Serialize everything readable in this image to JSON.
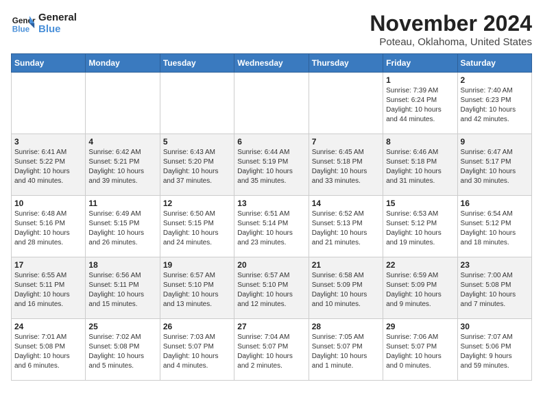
{
  "header": {
    "logo_line1": "General",
    "logo_line2": "Blue",
    "title": "November 2024",
    "subtitle": "Poteau, Oklahoma, United States"
  },
  "weekdays": [
    "Sunday",
    "Monday",
    "Tuesday",
    "Wednesday",
    "Thursday",
    "Friday",
    "Saturday"
  ],
  "weeks": [
    [
      {
        "day": "",
        "detail": ""
      },
      {
        "day": "",
        "detail": ""
      },
      {
        "day": "",
        "detail": ""
      },
      {
        "day": "",
        "detail": ""
      },
      {
        "day": "",
        "detail": ""
      },
      {
        "day": "1",
        "detail": "Sunrise: 7:39 AM\nSunset: 6:24 PM\nDaylight: 10 hours\nand 44 minutes."
      },
      {
        "day": "2",
        "detail": "Sunrise: 7:40 AM\nSunset: 6:23 PM\nDaylight: 10 hours\nand 42 minutes."
      }
    ],
    [
      {
        "day": "3",
        "detail": "Sunrise: 6:41 AM\nSunset: 5:22 PM\nDaylight: 10 hours\nand 40 minutes."
      },
      {
        "day": "4",
        "detail": "Sunrise: 6:42 AM\nSunset: 5:21 PM\nDaylight: 10 hours\nand 39 minutes."
      },
      {
        "day": "5",
        "detail": "Sunrise: 6:43 AM\nSunset: 5:20 PM\nDaylight: 10 hours\nand 37 minutes."
      },
      {
        "day": "6",
        "detail": "Sunrise: 6:44 AM\nSunset: 5:19 PM\nDaylight: 10 hours\nand 35 minutes."
      },
      {
        "day": "7",
        "detail": "Sunrise: 6:45 AM\nSunset: 5:18 PM\nDaylight: 10 hours\nand 33 minutes."
      },
      {
        "day": "8",
        "detail": "Sunrise: 6:46 AM\nSunset: 5:18 PM\nDaylight: 10 hours\nand 31 minutes."
      },
      {
        "day": "9",
        "detail": "Sunrise: 6:47 AM\nSunset: 5:17 PM\nDaylight: 10 hours\nand 30 minutes."
      }
    ],
    [
      {
        "day": "10",
        "detail": "Sunrise: 6:48 AM\nSunset: 5:16 PM\nDaylight: 10 hours\nand 28 minutes."
      },
      {
        "day": "11",
        "detail": "Sunrise: 6:49 AM\nSunset: 5:15 PM\nDaylight: 10 hours\nand 26 minutes."
      },
      {
        "day": "12",
        "detail": "Sunrise: 6:50 AM\nSunset: 5:15 PM\nDaylight: 10 hours\nand 24 minutes."
      },
      {
        "day": "13",
        "detail": "Sunrise: 6:51 AM\nSunset: 5:14 PM\nDaylight: 10 hours\nand 23 minutes."
      },
      {
        "day": "14",
        "detail": "Sunrise: 6:52 AM\nSunset: 5:13 PM\nDaylight: 10 hours\nand 21 minutes."
      },
      {
        "day": "15",
        "detail": "Sunrise: 6:53 AM\nSunset: 5:12 PM\nDaylight: 10 hours\nand 19 minutes."
      },
      {
        "day": "16",
        "detail": "Sunrise: 6:54 AM\nSunset: 5:12 PM\nDaylight: 10 hours\nand 18 minutes."
      }
    ],
    [
      {
        "day": "17",
        "detail": "Sunrise: 6:55 AM\nSunset: 5:11 PM\nDaylight: 10 hours\nand 16 minutes."
      },
      {
        "day": "18",
        "detail": "Sunrise: 6:56 AM\nSunset: 5:11 PM\nDaylight: 10 hours\nand 15 minutes."
      },
      {
        "day": "19",
        "detail": "Sunrise: 6:57 AM\nSunset: 5:10 PM\nDaylight: 10 hours\nand 13 minutes."
      },
      {
        "day": "20",
        "detail": "Sunrise: 6:57 AM\nSunset: 5:10 PM\nDaylight: 10 hours\nand 12 minutes."
      },
      {
        "day": "21",
        "detail": "Sunrise: 6:58 AM\nSunset: 5:09 PM\nDaylight: 10 hours\nand 10 minutes."
      },
      {
        "day": "22",
        "detail": "Sunrise: 6:59 AM\nSunset: 5:09 PM\nDaylight: 10 hours\nand 9 minutes."
      },
      {
        "day": "23",
        "detail": "Sunrise: 7:00 AM\nSunset: 5:08 PM\nDaylight: 10 hours\nand 7 minutes."
      }
    ],
    [
      {
        "day": "24",
        "detail": "Sunrise: 7:01 AM\nSunset: 5:08 PM\nDaylight: 10 hours\nand 6 minutes."
      },
      {
        "day": "25",
        "detail": "Sunrise: 7:02 AM\nSunset: 5:08 PM\nDaylight: 10 hours\nand 5 minutes."
      },
      {
        "day": "26",
        "detail": "Sunrise: 7:03 AM\nSunset: 5:07 PM\nDaylight: 10 hours\nand 4 minutes."
      },
      {
        "day": "27",
        "detail": "Sunrise: 7:04 AM\nSunset: 5:07 PM\nDaylight: 10 hours\nand 2 minutes."
      },
      {
        "day": "28",
        "detail": "Sunrise: 7:05 AM\nSunset: 5:07 PM\nDaylight: 10 hours\nand 1 minute."
      },
      {
        "day": "29",
        "detail": "Sunrise: 7:06 AM\nSunset: 5:07 PM\nDaylight: 10 hours\nand 0 minutes."
      },
      {
        "day": "30",
        "detail": "Sunrise: 7:07 AM\nSunset: 5:06 PM\nDaylight: 9 hours\nand 59 minutes."
      }
    ]
  ]
}
